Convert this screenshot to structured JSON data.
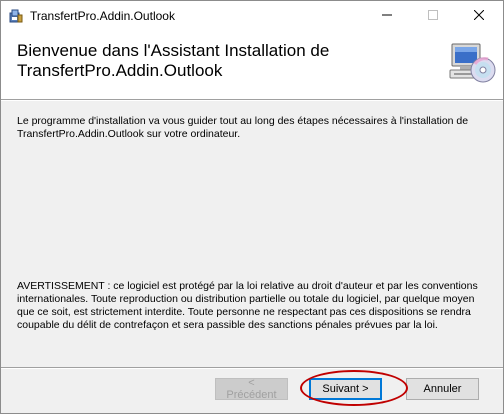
{
  "window": {
    "title": "TransfertPro.Addin.Outlook",
    "icons": {
      "app": "installer-app-icon",
      "minimize": "minimize-icon",
      "maximize": "maximize-icon",
      "close": "close-icon"
    }
  },
  "header": {
    "title": "Bienvenue dans l'Assistant Installation de TransfertPro.Addin.Outlook",
    "icon": "computer-cd-icon"
  },
  "body": {
    "intro": "Le programme d'installation va vous guider tout au long des étapes nécessaires à l'installation de TransfertPro.Addin.Outlook sur votre ordinateur.",
    "warning": "AVERTISSEMENT : ce logiciel est protégé par la loi relative au droit d'auteur et par les conventions internationales. Toute reproduction ou distribution partielle ou totale du logiciel, par quelque moyen que ce soit, est strictement interdite. Toute personne ne respectant pas ces dispositions se rendra coupable du délit de contrefaçon et sera passible des sanctions pénales prévues par la loi."
  },
  "buttons": {
    "prev_label": "< Précédent",
    "prev_enabled": false,
    "next_label": "Suivant >",
    "next_highlighted": true,
    "cancel_label": "Annuler"
  },
  "colors": {
    "highlight_ring": "#c00000",
    "focus_border": "#0078d7"
  }
}
